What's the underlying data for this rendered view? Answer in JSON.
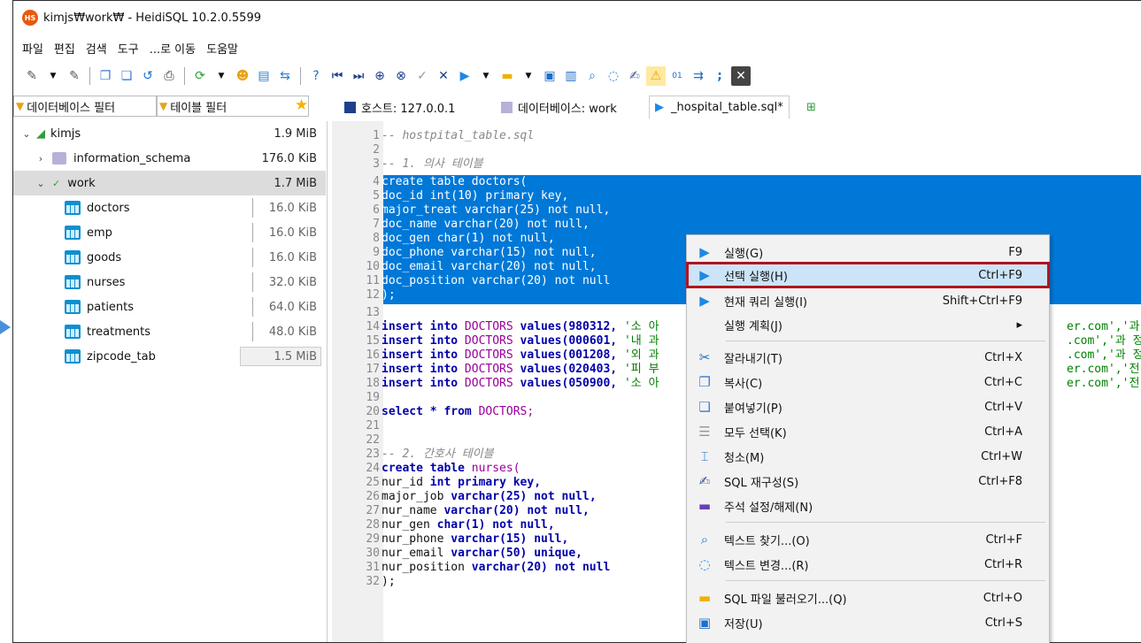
{
  "window": {
    "title": "kimjs₩work₩ - HeidiSQL 10.2.0.5599",
    "app_badge": "HS"
  },
  "menu": [
    "파일",
    "편집",
    "검색",
    "도구",
    "...로 이동",
    "도움말"
  ],
  "filters": {
    "db_filter": "데이터베이스 필터",
    "table_filter": "테이블 필터"
  },
  "tabs": [
    {
      "label": "호스트: 127.0.0.1"
    },
    {
      "label": "데이터베이스: work"
    },
    {
      "label": "_hospital_table.sql*"
    }
  ],
  "tree": {
    "root": {
      "label": "kimjs",
      "size": "1.9 MiB"
    },
    "schemas": [
      {
        "label": "information_schema",
        "size": "176.0 KiB"
      },
      {
        "label": "work",
        "size": "1.7 MiB"
      }
    ],
    "tables": [
      {
        "label": "doctors",
        "size": "16.0 KiB"
      },
      {
        "label": "emp",
        "size": "16.0 KiB"
      },
      {
        "label": "goods",
        "size": "16.0 KiB"
      },
      {
        "label": "nurses",
        "size": "32.0 KiB"
      },
      {
        "label": "patients",
        "size": "64.0 KiB"
      },
      {
        "label": "treatments",
        "size": "48.0 KiB"
      },
      {
        "label": "zipcode_tab",
        "size": "1.5 MiB"
      }
    ]
  },
  "editor": {
    "lines": [
      "1",
      "2",
      "3",
      "4",
      "5",
      "6",
      "7",
      "8",
      "9",
      "10",
      "11",
      "12",
      "13",
      "14",
      "15",
      "16",
      "17",
      "18",
      "19",
      "20",
      "21",
      "22",
      "23",
      "24",
      "25",
      "26",
      "27",
      "28",
      "29",
      "30",
      "31",
      "32"
    ],
    "code": {
      "l1": "-- hostpital_table.sql",
      "l3": "-- 1. 의사 테이블",
      "l4": "create table doctors(",
      "l5": "doc_id int(10) primary key,",
      "l6": "major_treat varchar(25) not null,",
      "l7": "doc_name varchar(20) not null,",
      "l8": "doc_gen char(1) not null,",
      "l9": "doc_phone varchar(15) not null,",
      "l10": "doc_email varchar(20) not null,",
      "l11": "doc_position varchar(20) not null",
      "l12": ");",
      "l14a": "insert into",
      "l14b": "DOCTORS",
      "l14c": "values(980312,",
      "l14d": "'소 아",
      "l15a": "insert into",
      "l15b": "DOCTORS",
      "l15c": "values(000601,",
      "l15d": "'내 과",
      "l16a": "insert into",
      "l16b": "DOCTORS",
      "l16c": "values(001208,",
      "l16d": "'외 과",
      "l17a": "insert into",
      "l17b": "DOCTORS",
      "l17c": "values(020403,",
      "l17d": "'피 부",
      "l18a": "insert into",
      "l18b": "DOCTORS",
      "l18c": "values(050900,",
      "l18d": "'소 아",
      "l20a": "select * from",
      "l20b": "DOCTORS;",
      "l23": "-- 2. 간호사 테이블",
      "l24a": "create table",
      "l24b": "nurses(",
      "l25a": "nur_id",
      "l25b": "int primary key,",
      "l26a": "major_job",
      "l26b": "varchar(25) not null,",
      "l27a": "nur_name",
      "l27b": "varchar(20) not null,",
      "l28a": "nur_gen",
      "l28b": "char(1) not null,",
      "l29a": "nur_phone",
      "l29b": "varchar(15) null,",
      "l30a": "nur_email",
      "l30b": "varchar(50) unique,",
      "l31a": "nur_position",
      "l31b": "varchar(20) not null",
      "l32": ");",
      "r14": "er.com','과",
      "r15": ".com','과 정",
      "r16": ".com','과 정",
      "r17": "er.com','전",
      "r18": "er.com','전"
    }
  },
  "context_menu": [
    {
      "label": "실행(G)",
      "key": "F9"
    },
    {
      "label": "선택 실행(H)",
      "key": "Ctrl+F9"
    },
    {
      "label": "현재 쿼리 실행(I)",
      "key": "Shift+Ctrl+F9"
    },
    {
      "label": "실행 계획(J)",
      "key": "▸"
    },
    {
      "label": "잘라내기(T)",
      "key": "Ctrl+X"
    },
    {
      "label": "복사(C)",
      "key": "Ctrl+C"
    },
    {
      "label": "붙여넣기(P)",
      "key": "Ctrl+V"
    },
    {
      "label": "모두 선택(K)",
      "key": "Ctrl+A"
    },
    {
      "label": "청소(M)",
      "key": "Ctrl+W"
    },
    {
      "label": "SQL 재구성(S)",
      "key": "Ctrl+F8"
    },
    {
      "label": "주석 설정/해제(N)",
      "key": ""
    },
    {
      "label": "텍스트 찾기...(O)",
      "key": "Ctrl+F"
    },
    {
      "label": "텍스트 변경...(R)",
      "key": "Ctrl+R"
    },
    {
      "label": "SQL 파일 불러오기...(Q)",
      "key": "Ctrl+O"
    },
    {
      "label": "저장(U)",
      "key": "Ctrl+S"
    }
  ]
}
